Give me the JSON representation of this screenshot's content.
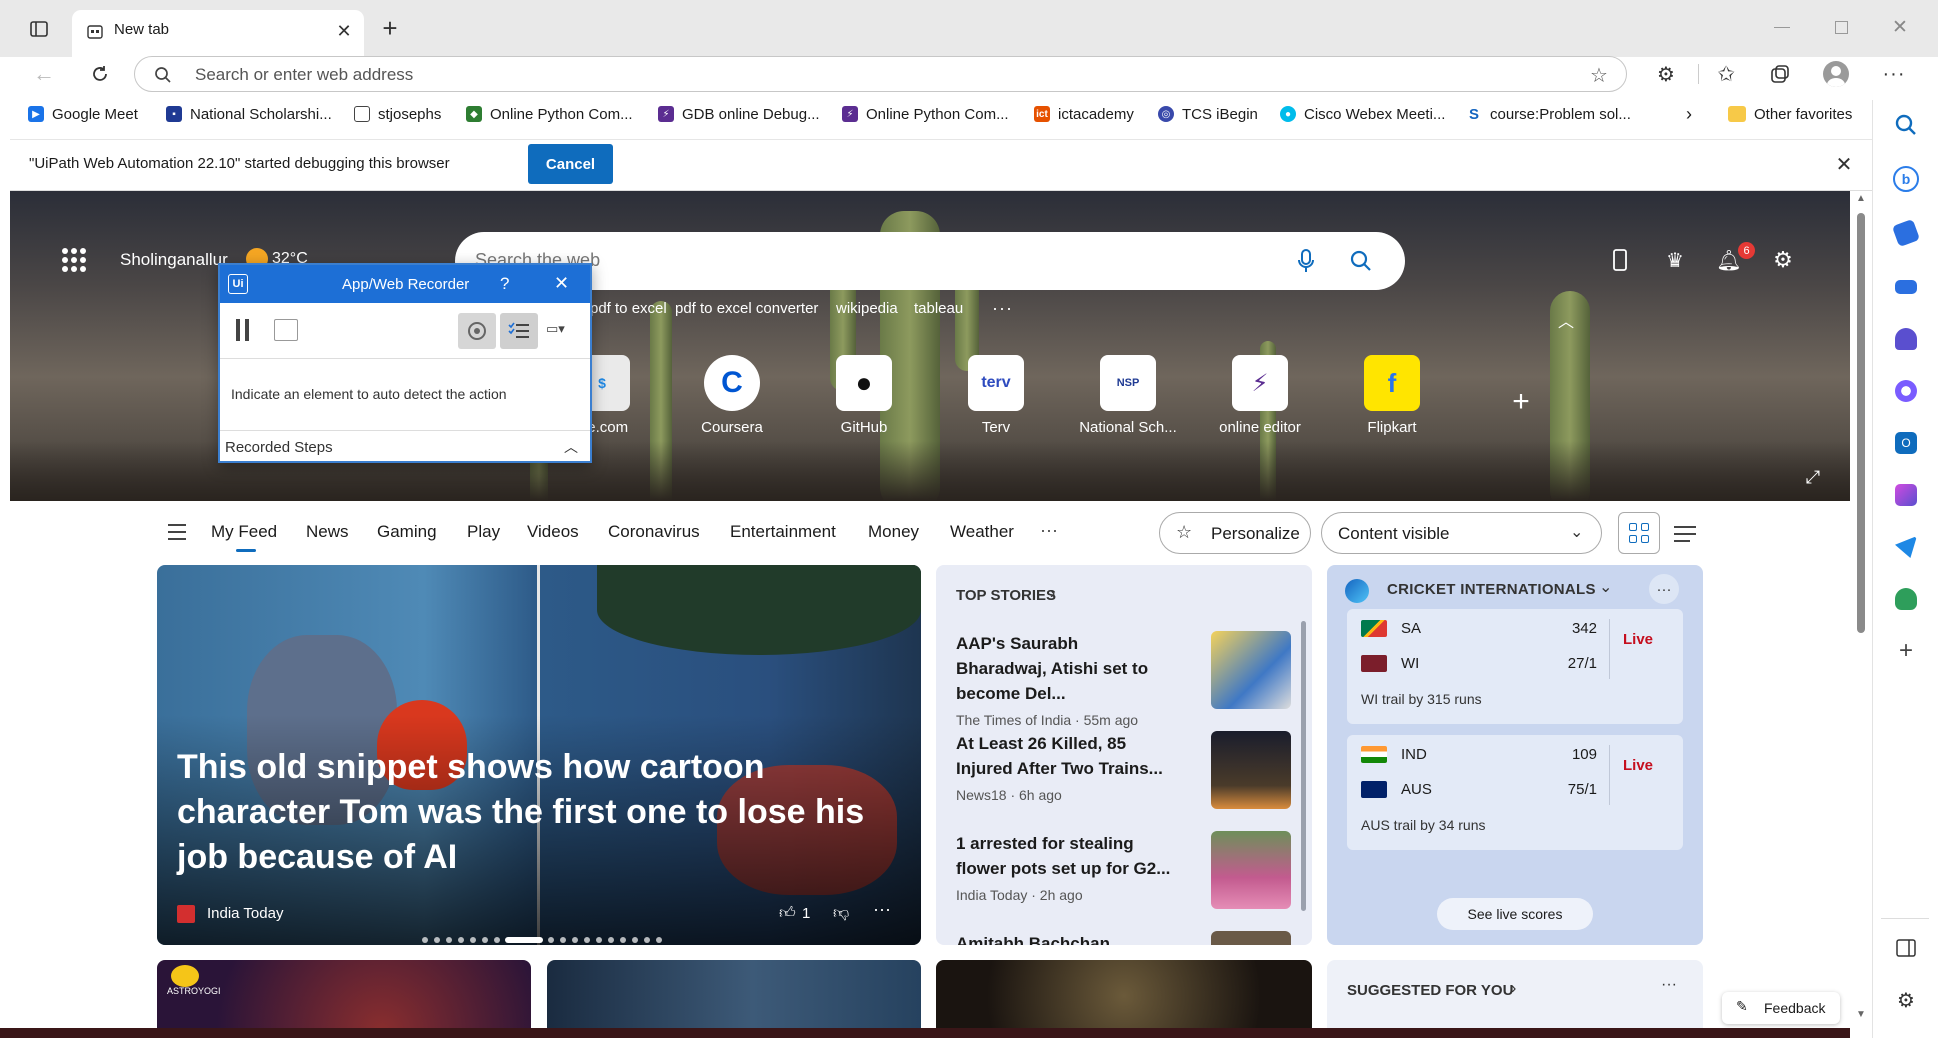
{
  "browser": {
    "tab_title": "New tab",
    "address_placeholder": "Search or enter web address",
    "favorites": [
      {
        "label": "Google Meet",
        "color": "#1a73e8"
      },
      {
        "label": "National Scholarshi...",
        "color": "#1f3a93"
      },
      {
        "label": "stjosephs",
        "color": "#666666"
      },
      {
        "label": "Online Python Com...",
        "color": "#2e7d32"
      },
      {
        "label": "GDB online Debug...",
        "color": "#5b2d91"
      },
      {
        "label": "Online Python Com...",
        "color": "#5b2d91"
      },
      {
        "label": "ictacademy",
        "color": "#e65100"
      },
      {
        "label": "TCS iBegin",
        "color": "#3949ab"
      },
      {
        "label": "Cisco Webex Meeti...",
        "color": "#00bceb"
      },
      {
        "label": "course:Problem sol...",
        "color": "#1565c0"
      }
    ],
    "other_favorites": "Other favorites"
  },
  "infobar": {
    "message": "\"UiPath Web Automation 22.10\" started debugging this browser",
    "cancel_label": "Cancel"
  },
  "newtab": {
    "location": "Sholinganallur",
    "temperature": "32°C",
    "search_placeholder": "Search the web",
    "trending": [
      "pdf to excel",
      "pdf to excel converter",
      "wikipedia",
      "tableau"
    ],
    "notification_count": "6",
    "tiles": [
      {
        "label": "ree.com",
        "glyph": "$"
      },
      {
        "label": "Coursera",
        "glyph": "C"
      },
      {
        "label": "GitHub",
        "glyph": "●"
      },
      {
        "label": "Terv",
        "glyph": "terv"
      },
      {
        "label": "National Sch...",
        "glyph": "NSP"
      },
      {
        "label": "online editor",
        "glyph": "⚡"
      },
      {
        "label": "Flipkart",
        "glyph": "f"
      }
    ]
  },
  "feed_nav": {
    "items": [
      "My Feed",
      "News",
      "Gaming",
      "Play",
      "Videos",
      "Coronavirus",
      "Entertainment",
      "Money",
      "Weather"
    ],
    "personalize_label": "Personalize",
    "content_select": "Content visible"
  },
  "hero_card": {
    "headline": "This old snippet shows how cartoon character Tom was the first one to lose his job because of AI",
    "source": "India Today",
    "likes": "1"
  },
  "top_stories": {
    "heading": "TOP STORIES",
    "stories": [
      {
        "title": "AAP's Saurabh Bharadwaj, Atishi set to become Del...",
        "meta": "The Times of India · 55m ago"
      },
      {
        "title": "At Least 26 Killed, 85 Injured After Two Trains...",
        "meta": "News18 · 6h ago"
      },
      {
        "title": "1 arrested for stealing flower pots set up for G2...",
        "meta": "India Today · 2h ago"
      },
      {
        "title": "Amitabh Bachchan",
        "meta": ""
      }
    ]
  },
  "cricket": {
    "heading": "CRICKET INTERNATIONALS",
    "matches": [
      {
        "team1": "SA",
        "score1": "342",
        "team2": "WI",
        "score2": "27/1",
        "status": "Live",
        "note": "WI trail by 315 runs"
      },
      {
        "team1": "IND",
        "score1": "109",
        "team2": "AUS",
        "score2": "75/1",
        "status": "Live",
        "note": "AUS trail by 34 runs"
      }
    ],
    "see_live": "See live scores"
  },
  "suggested": {
    "heading": "SUGGESTED FOR YOU"
  },
  "feedback_label": "Feedback",
  "recorder": {
    "title": "App/Web Recorder",
    "help": "?",
    "instruction": "Indicate an element to auto detect the action",
    "steps_label": "Recorded Steps"
  },
  "astro_label": "ASTROYOGI",
  "colors": {
    "accent": "#0f6cbd",
    "live": "#c50f1f",
    "recorder_blue": "#1d6fd6"
  }
}
